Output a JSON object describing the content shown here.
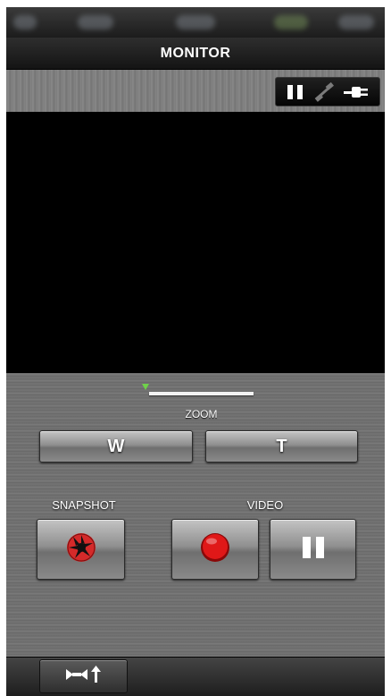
{
  "header": {
    "title": "MONITOR"
  },
  "toolbar": {
    "icons": [
      "pause-icon",
      "link-icon",
      "plug-icon"
    ]
  },
  "zoom": {
    "label": "ZOOM",
    "level": 0,
    "wide_label": "W",
    "tele_label": "T"
  },
  "snapshot": {
    "label": "SNAPSHOT",
    "icon": "shutter-icon",
    "color": "#d42a2a"
  },
  "video": {
    "label": "VIDEO",
    "record_icon": "record-icon",
    "pause_icon": "pause-icon",
    "record_color": "#e01818"
  },
  "footer": {
    "icon": "switch-mode-icon"
  }
}
